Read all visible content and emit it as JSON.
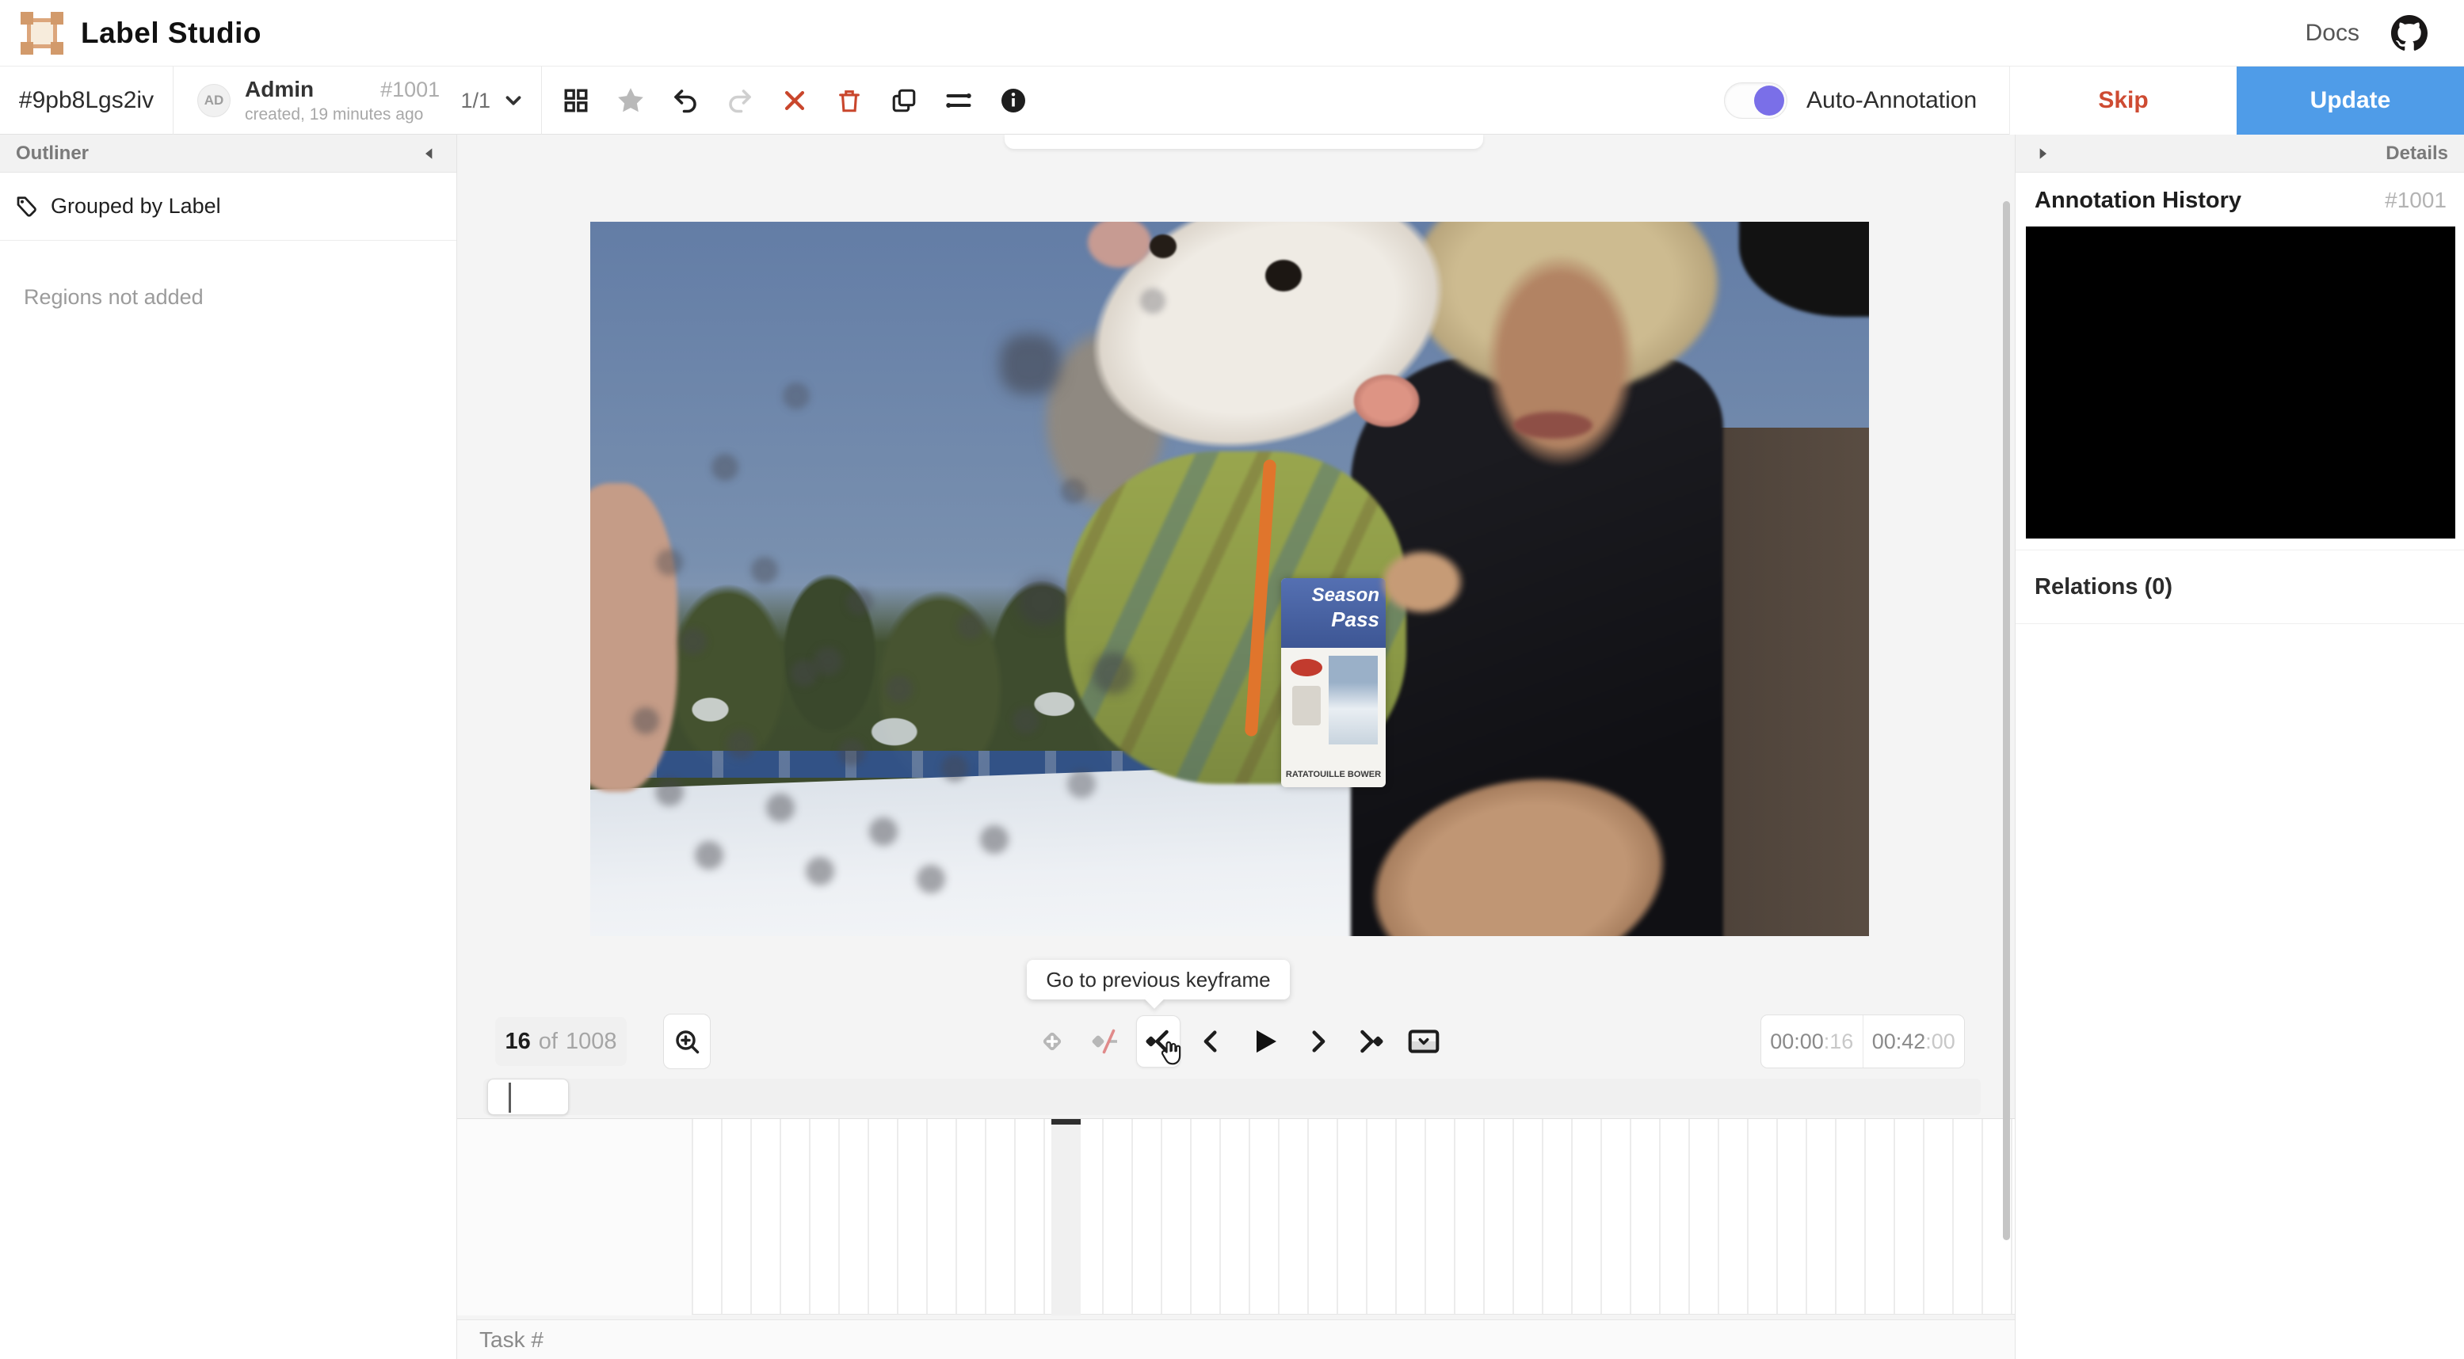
{
  "header": {
    "title": "Label Studio",
    "docs_label": "Docs"
  },
  "taskbar": {
    "task_id": "#9pb8Lgs2iv",
    "avatar_initials": "AD",
    "author": "Admin",
    "annotation_id": "#1001",
    "created": "created, 19 minutes ago",
    "pagination": "1/1",
    "auto_annotation_label": "Auto-Annotation",
    "skip_label": "Skip",
    "update_label": "Update"
  },
  "toolbar": {
    "icons": [
      "grid-view-icon",
      "star-icon",
      "undo-icon",
      "redo-icon",
      "reject-icon",
      "delete-icon",
      "duplicate-icon",
      "settings-icon",
      "info-icon"
    ]
  },
  "outliner": {
    "title": "Outliner",
    "grouped_by": "Grouped by Label",
    "empty": "Regions not added"
  },
  "details": {
    "title": "Details",
    "annotation_history": "Annotation History",
    "annotation_id": "#1001",
    "relations": "Relations (0)"
  },
  "video": {
    "frame_current": "16",
    "frame_separator": "of",
    "frame_total": "1008",
    "position_time": "00:00",
    "position_frames": ":16",
    "duration_time": "00:42",
    "duration_frames": ":00",
    "tooltip": "Go to previous keyframe",
    "badge_line1": "Season",
    "badge_line2": "Pass",
    "badge_caption": "RATATOUILLE BOWER"
  },
  "footer": {
    "task_label": "Task #"
  },
  "colors": {
    "accent_blue": "#4f9ce8",
    "danger_red": "#ce4b32",
    "toggle_purple": "#7a6fe8",
    "logo_orange": "#dca67c",
    "panel_gray": "#f2f2f2"
  }
}
